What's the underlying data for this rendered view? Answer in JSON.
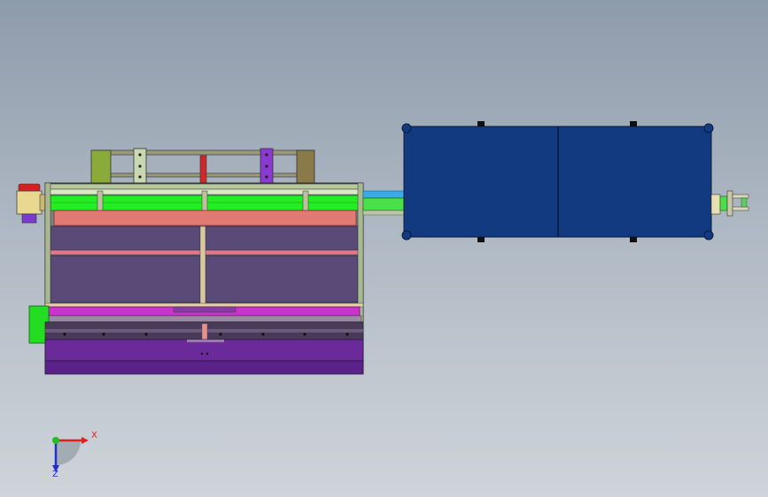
{
  "viewport": {
    "background_top": "#8e9bab",
    "background_bottom": "#cfd4da"
  },
  "model": {
    "machine_colors": {
      "frame_outline": "#3a4a3a",
      "green_rail": "#22ee22",
      "salmon_plate": "#e07a72",
      "tray_panel": "#5a4a78",
      "magenta_rail": "#cc33cc",
      "purple_base": "#6a2a9a",
      "blue_panel": "#123a80",
      "cyan_shaft": "#3aaae8"
    }
  },
  "triad": {
    "x_label": "X",
    "z_label": "Z",
    "x_color": "#e02020",
    "y_color": "#20c020",
    "z_color": "#2030d0"
  }
}
